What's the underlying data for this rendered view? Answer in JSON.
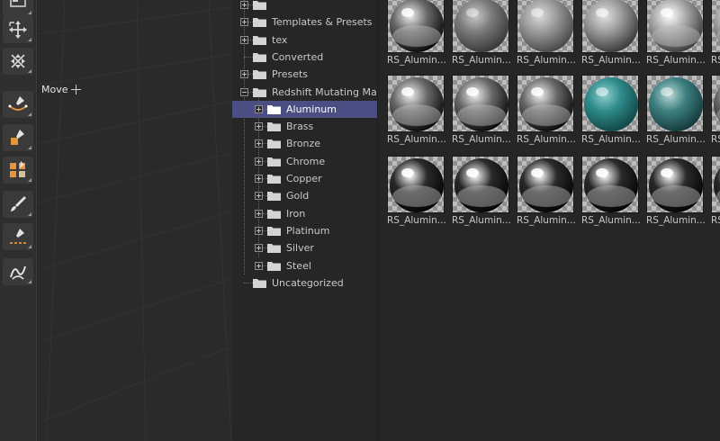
{
  "toolbar": {
    "tools": [
      {
        "name": "top-tool",
        "icon": "panel-icon"
      },
      {
        "name": "move-tool",
        "icon": "move-arrows-icon"
      },
      {
        "name": "scale-tool",
        "icon": "scale-arrows-icon"
      },
      {
        "name": "spline-pen-tool",
        "icon": "spline-pen-icon"
      },
      {
        "name": "object-pen-tool",
        "icon": "pen-cube-icon"
      },
      {
        "name": "cloner-tool",
        "icon": "cubes-icon"
      },
      {
        "name": "brush-tool",
        "icon": "brush-icon"
      },
      {
        "name": "knife-tool",
        "icon": "knife-line-icon"
      },
      {
        "name": "sketch-tool",
        "icon": "squiggle-icon"
      }
    ]
  },
  "viewport": {
    "tooltip": "Move"
  },
  "tree": {
    "rows": [
      {
        "label": "",
        "indent": 0,
        "expander": "plus"
      },
      {
        "label": "Templates & Presets",
        "indent": 0,
        "expander": "plus"
      },
      {
        "label": "tex",
        "indent": 0,
        "expander": "plus"
      },
      {
        "label": "Converted",
        "indent": 0,
        "expander": "none"
      },
      {
        "label": "Presets",
        "indent": 0,
        "expander": "plus"
      },
      {
        "label": "Redshift Mutating Materials",
        "indent": 0,
        "expander": "minus"
      },
      {
        "label": "Aluminum",
        "indent": 1,
        "expander": "plus",
        "selected": true
      },
      {
        "label": "Brass",
        "indent": 1,
        "expander": "plus"
      },
      {
        "label": "Bronze",
        "indent": 1,
        "expander": "plus"
      },
      {
        "label": "Chrome",
        "indent": 1,
        "expander": "plus"
      },
      {
        "label": "Copper",
        "indent": 1,
        "expander": "plus"
      },
      {
        "label": "Gold",
        "indent": 1,
        "expander": "plus"
      },
      {
        "label": "Iron",
        "indent": 1,
        "expander": "plus"
      },
      {
        "label": "Platinum",
        "indent": 1,
        "expander": "plus"
      },
      {
        "label": "Silver",
        "indent": 1,
        "expander": "plus"
      },
      {
        "label": "Steel",
        "indent": 1,
        "expander": "plus"
      },
      {
        "label": "Uncategorized",
        "indent": 0,
        "expander": "none"
      }
    ]
  },
  "materials": {
    "items": [
      {
        "caption": "RS_Aluminum",
        "style": "chrome-dark"
      },
      {
        "caption": "RS_Aluminum",
        "style": "rough-grey"
      },
      {
        "caption": "RS_Aluminum",
        "style": "speckled"
      },
      {
        "caption": "RS_Aluminum",
        "style": "brushed"
      },
      {
        "caption": "RS_Aluminum",
        "style": "satin"
      },
      {
        "caption": "RS_Aluminum",
        "style": "satin"
      },
      {
        "caption": "RS_Aluminum",
        "style": "chrome-dark"
      },
      {
        "caption": "RS_Aluminum",
        "style": "chrome-dark"
      },
      {
        "caption": "RS_Aluminum",
        "style": "chrome-dark"
      },
      {
        "caption": "RS_Aluminum",
        "style": "teal"
      },
      {
        "caption": "RS_Aluminum",
        "style": "teal-rough"
      },
      {
        "caption": "RS_Aluminum",
        "style": "chrome-dark"
      },
      {
        "caption": "RS_Aluminum",
        "style": "mirror"
      },
      {
        "caption": "RS_Aluminum",
        "style": "mirror"
      },
      {
        "caption": "RS_Aluminum",
        "style": "mirror"
      },
      {
        "caption": "RS_Aluminum",
        "style": "mirror"
      },
      {
        "caption": "RS_Aluminum",
        "style": "mirror"
      },
      {
        "caption": "RS_Aluminum",
        "style": "mirror"
      }
    ]
  },
  "colors": {
    "selection": "#4a4e83",
    "teal": "#2f8a8a",
    "accent_orange": "#e8953a"
  }
}
